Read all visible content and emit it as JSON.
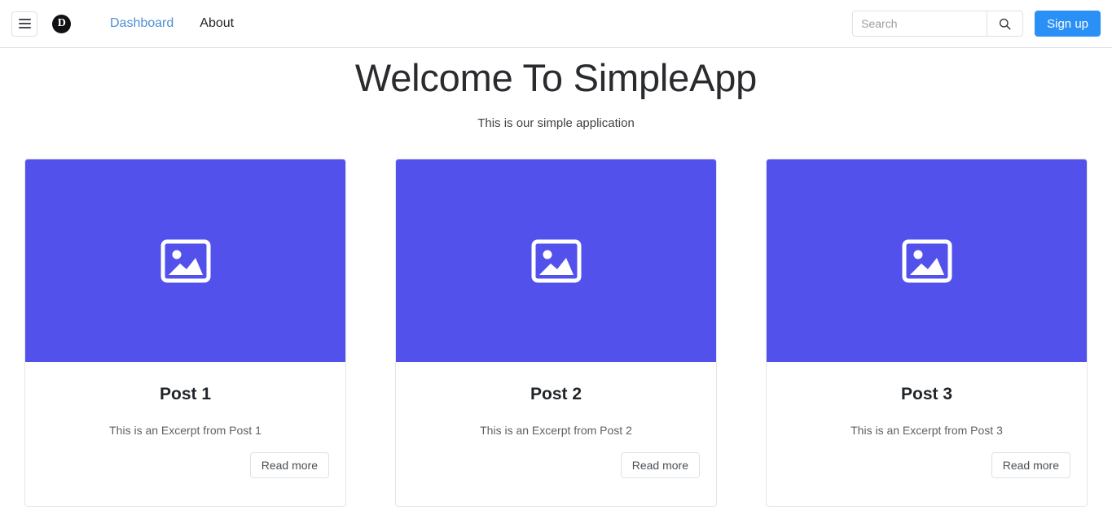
{
  "navbar": {
    "menu_toggle_label": "Toggle navigation",
    "brand_glyph": "D",
    "links": [
      {
        "label": "Dashboard",
        "state": "active"
      },
      {
        "label": "About",
        "state": "plain"
      }
    ],
    "search": {
      "placeholder": "Search",
      "value": "",
      "button_icon": "search-icon"
    },
    "signup_label": "Sign up",
    "accent_color": "#2b90f5",
    "link_active_color": "#4d8fd4"
  },
  "hero": {
    "title": "Welcome To SimpleApp",
    "subtitle": "This is our simple application"
  },
  "cards": {
    "image_placeholder_icon": "image-placeholder-icon",
    "image_background_color": "#5251ec",
    "items": [
      {
        "title": "Post 1",
        "excerpt": "This is an Excerpt from Post 1",
        "action_label": "Read more"
      },
      {
        "title": "Post 2",
        "excerpt": "This is an Excerpt from Post 2",
        "action_label": "Read more"
      },
      {
        "title": "Post 3",
        "excerpt": "This is an Excerpt from Post 3",
        "action_label": "Read more"
      }
    ]
  }
}
